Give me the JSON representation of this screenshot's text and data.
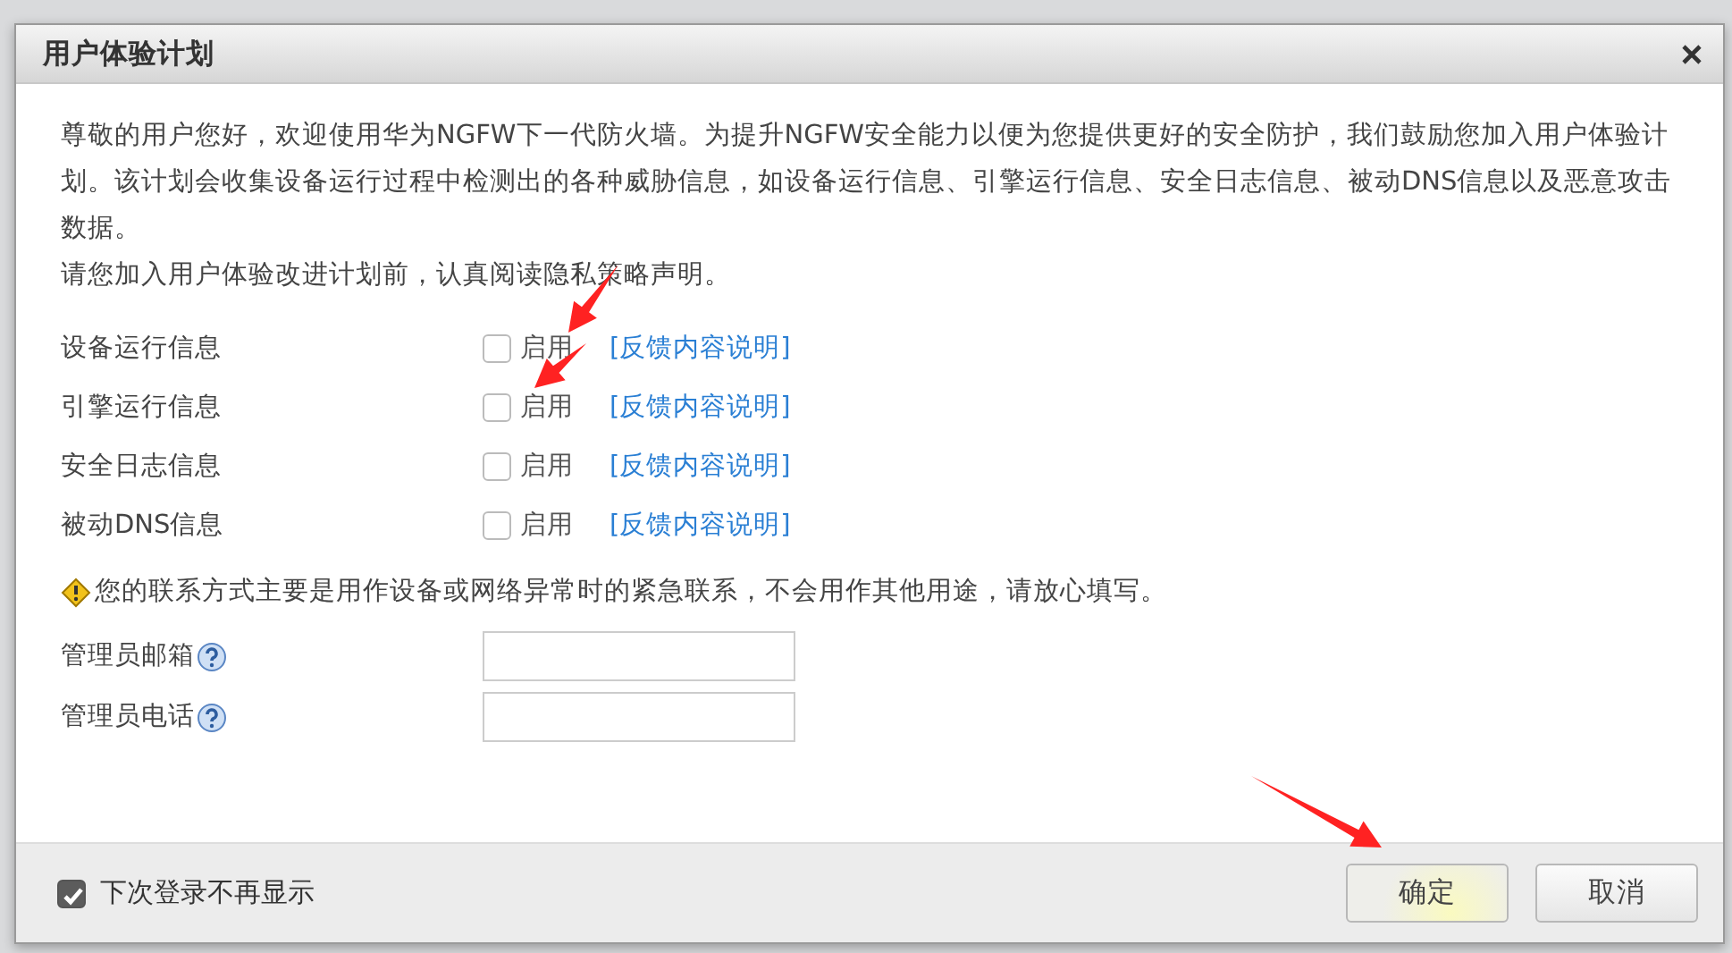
{
  "dialog": {
    "title": "用户体验计划",
    "intro": "尊敬的用户您好，欢迎使用华为NGFW下一代防火墙。为提升NGFW安全能力以便为您提供更好的安全防护，我们鼓励您加入用户体验计划。该计划会收集设备运行过程中检测出的各种威胁信息，如设备运行信息、引擎运行信息、安全日志信息、被动DNS信息以及恶意攻击数据。",
    "privacy_note": "请您加入用户体验改进计划前，认真阅读隐私策略声明。",
    "options": [
      {
        "label": "设备运行信息",
        "checked": false,
        "checkbox_label": "启用",
        "link": "[反馈内容说明]"
      },
      {
        "label": "引擎运行信息",
        "checked": false,
        "checkbox_label": "启用",
        "link": "[反馈内容说明]"
      },
      {
        "label": "安全日志信息",
        "checked": false,
        "checkbox_label": "启用",
        "link": "[反馈内容说明]"
      },
      {
        "label": "被动DNS信息",
        "checked": false,
        "checkbox_label": "启用",
        "link": "[反馈内容说明]"
      }
    ],
    "contact_note": "您的联系方式主要是用作设备或网络异常时的紧急联系，不会用作其他用途，请放心填写。",
    "fields": [
      {
        "label": "管理员邮箱"
      },
      {
        "label": "管理员电话"
      }
    ],
    "footer": {
      "dont_show_again": {
        "label": "下次登录不再显示",
        "checked": true
      },
      "buttons": [
        "确定",
        "取消"
      ]
    }
  }
}
